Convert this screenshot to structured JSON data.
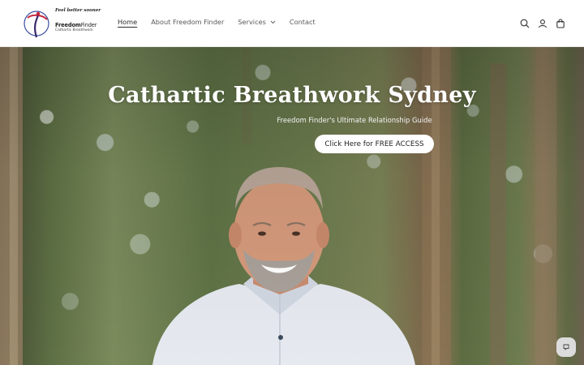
{
  "brand": {
    "tagline": "Feel better sooner",
    "name_bold": "Freedom",
    "name_thin": "Finder",
    "subtitle": "Cathartic Breathwork",
    "colors": {
      "accent_red": "#c7243a",
      "accent_blue": "#3b4fa0",
      "accent_dark": "#3a2a6a"
    }
  },
  "nav": {
    "items": [
      {
        "label": "Home",
        "active": true
      },
      {
        "label": "About Freedom Finder",
        "active": false
      },
      {
        "label": "Services",
        "active": false,
        "has_dropdown": true
      },
      {
        "label": "Contact",
        "active": false
      }
    ]
  },
  "header_icons": [
    "search-icon",
    "account-icon",
    "cart-icon"
  ],
  "hero": {
    "title": "Cathartic Breathwork Sydney",
    "subtitle": "Freedom Finder's Ultimate Relationship Guide",
    "cta_label": "Click Here for FREE ACCESS"
  },
  "chat_widget": {
    "icon": "chat-icon"
  }
}
